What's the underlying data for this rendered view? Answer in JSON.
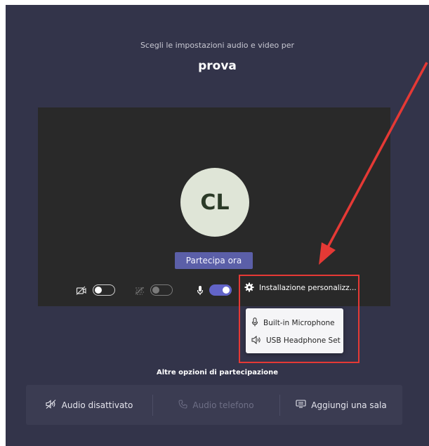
{
  "prejoin": {
    "subtitle": "Scegli le impostazioni audio e video per",
    "meeting_name": "prova"
  },
  "preview": {
    "avatar_initials": "CL",
    "join_button_label": "Partecipa ora"
  },
  "controls": {
    "camera": {
      "icon": "camera-off-icon",
      "enabled": false
    },
    "background_blur": {
      "icon": "background-blur-icon",
      "enabled": false
    },
    "microphone": {
      "icon": "microphone-icon",
      "enabled": true
    },
    "settings_label": "Installazione personalizz..."
  },
  "device_menu": {
    "items": [
      {
        "icon": "microphone-icon",
        "label": "Built-in Microphone"
      },
      {
        "icon": "speaker-icon",
        "label": "USB Headphone Set"
      }
    ]
  },
  "other_options": {
    "title": "Altre opzioni di partecipazione",
    "items": [
      {
        "icon": "speaker-muted-icon",
        "label": "Audio disattivato",
        "enabled": true
      },
      {
        "icon": "phone-icon",
        "label": "Audio telefono",
        "enabled": false
      },
      {
        "icon": "room-icon",
        "label": "Aggiungi una sala",
        "enabled": true
      }
    ]
  },
  "colors": {
    "background": "#33344a",
    "preview": "#292929",
    "accent": "#6264c8",
    "join_button": "#5b5fa8",
    "annotation": "#e53935"
  }
}
